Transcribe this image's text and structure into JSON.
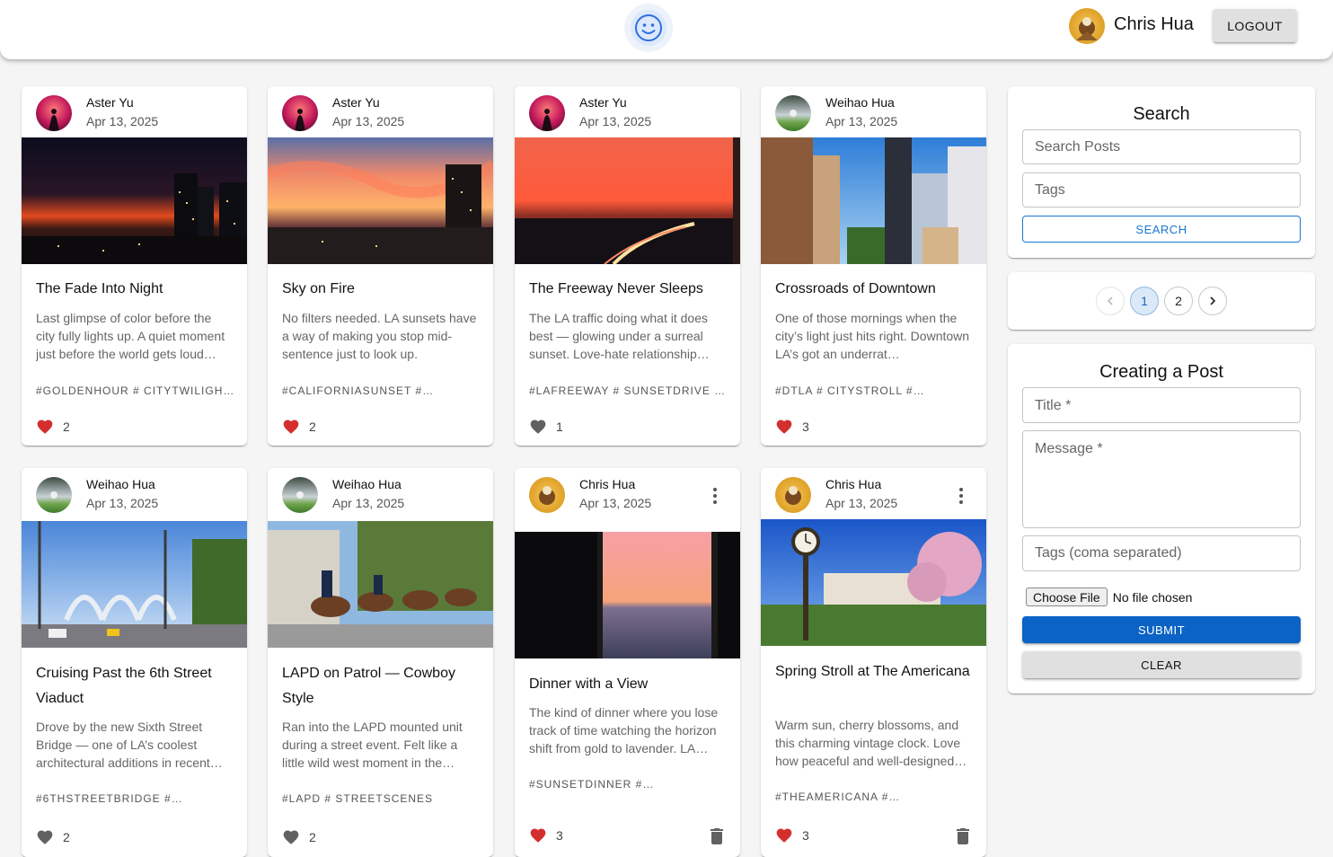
{
  "header": {
    "user_name": "Chris Hua",
    "logout_label": "LOGOUT"
  },
  "posts": [
    {
      "author": "Aster Yu",
      "date": "Apr 13, 2025",
      "title": "The Fade Into Night",
      "message": "Last glimpse of color before the city fully lights up. A quiet moment just before the world gets loud…",
      "tags": "#GOLDENHOUR # CITYTWILIGH…",
      "likes": "2",
      "liked": true
    },
    {
      "author": "Aster Yu",
      "date": "Apr 13, 2025",
      "title": "Sky on Fire",
      "message": "No filters needed. LA sunsets have a way of making you stop mid-sentence just to look up.",
      "tags": "#CALIFORNIASUNSET #…",
      "likes": "2",
      "liked": true
    },
    {
      "author": "Aster Yu",
      "date": "Apr 13, 2025",
      "title": "The Freeway Never Sleeps",
      "message": "The LA traffic doing what it does best — glowing under a surreal sunset. Love-hate relationship…",
      "tags": "#LAFREEWAY # SUNSETDRIVE …",
      "likes": "1",
      "liked": false
    },
    {
      "author": "Weihao Hua",
      "date": "Apr 13, 2025",
      "title": "Crossroads of Downtown",
      "message": "One of those mornings when the city’s light just hits right. Downtown LA’s got an underrat…",
      "tags": "#DTLA # CITYSTROLL #…",
      "likes": "3",
      "liked": true
    },
    {
      "author": "Weihao Hua",
      "date": "Apr 13, 2025",
      "title": "Cruising Past the 6th Street Viaduct",
      "message": "Drove by the new Sixth Street Bridge — one of LA’s coolest architectural additions in recent…",
      "tags": "#6THSTREETBRIDGE #…",
      "likes": "2",
      "liked": false
    },
    {
      "author": "Weihao Hua",
      "date": "Apr 13, 2025",
      "title": "LAPD on Patrol — Cowboy Style",
      "message": "Ran into the LAPD mounted unit during a street event. Felt like a little wild west moment in the…",
      "tags": "#LAPD # STREETSCENES",
      "likes": "2",
      "liked": false
    },
    {
      "author": "Chris Hua",
      "date": "Apr 13, 2025",
      "title": "Dinner with a View",
      "message": "The kind of dinner where you lose track of time watching the horizon shift from gold to lavender. LA…",
      "tags": "#SUNSETDINNER #…",
      "likes": "3",
      "liked": true
    },
    {
      "author": "Chris Hua",
      "date": "Apr 13, 2025",
      "title": "Spring Stroll at The Americana",
      "message": "Warm sun, cherry blossoms, and this charming vintage clock. Love how peaceful and well-designed…",
      "tags": "#THEAMERICANA #…",
      "likes": "3",
      "liked": true
    }
  ],
  "search": {
    "title": "Search",
    "search_placeholder": "Search Posts",
    "tags_placeholder": "Tags",
    "button_label": "SEARCH"
  },
  "pagination": {
    "pages": [
      "1",
      "2"
    ],
    "current": "1"
  },
  "form": {
    "title": "Creating a Post",
    "title_label": "Title *",
    "message_label": "Message *",
    "tags_placeholder": "Tags (coma separated)",
    "file_button": "Choose File",
    "file_status": "No file chosen",
    "submit_label": "SUBMIT",
    "clear_label": "CLEAR"
  },
  "colors": {
    "like_active": "#d32f2f",
    "like_inactive": "#616161",
    "primary": "#0b63c5",
    "outline": "#1976d2"
  },
  "icons": {
    "like": "heart-icon",
    "more": "more-vert-icon",
    "delete": "trash-icon",
    "prev": "chevron-left-icon",
    "next": "chevron-right-icon",
    "logo": "smiley-icon"
  }
}
